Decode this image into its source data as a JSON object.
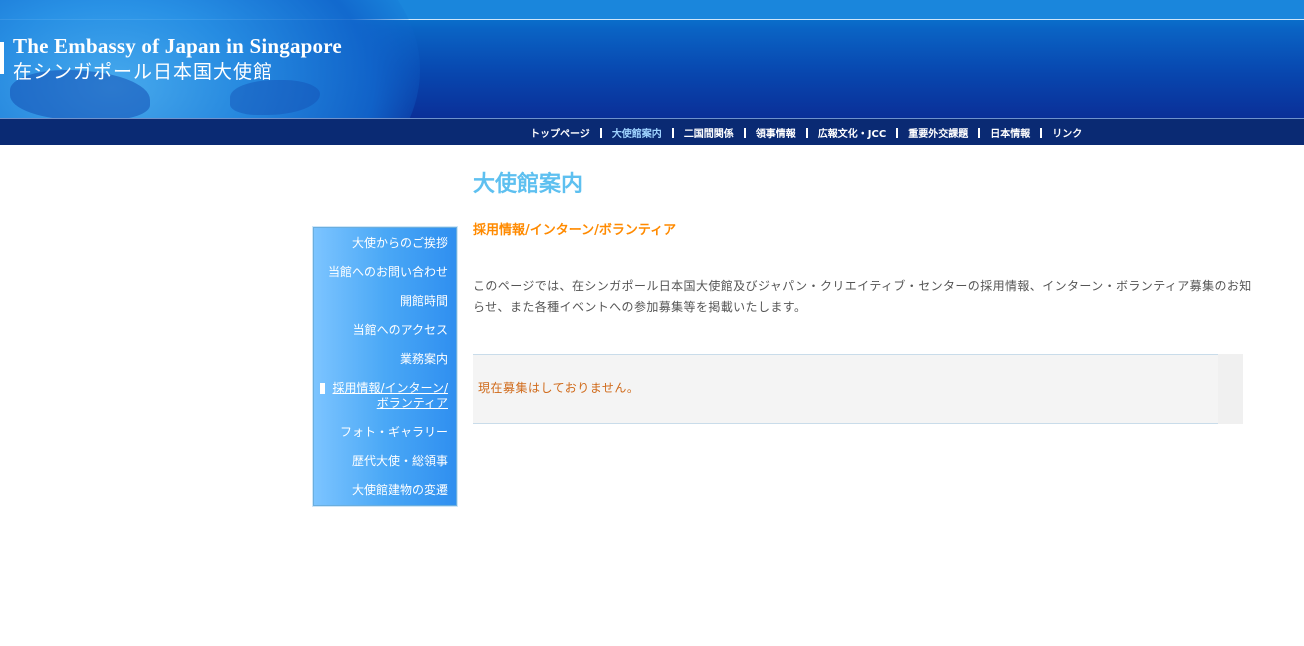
{
  "header": {
    "title_en": "The Embassy of Japan in Singapore",
    "title_ja": "在シンガポール日本国大使館"
  },
  "nav": {
    "items": [
      {
        "label": "トップページ"
      },
      {
        "label": "大使館案内"
      },
      {
        "label": "二国間関係"
      },
      {
        "label": "領事情報"
      },
      {
        "label": "広報文化・JCC"
      },
      {
        "label": "重要外交課題"
      },
      {
        "label": "日本情報"
      },
      {
        "label": "リンク"
      }
    ],
    "active": "大使館案内"
  },
  "sidebar": {
    "items": [
      {
        "label": "大使からのご挨拶"
      },
      {
        "label": "当館へのお問い合わせ"
      },
      {
        "label": "開館時間"
      },
      {
        "label": "当館へのアクセス"
      },
      {
        "label": "業務案内"
      },
      {
        "label": "採用情報/インターン/ボランティア",
        "line1": "採用情報/インターン/",
        "line2": "ボランティア"
      },
      {
        "label": "フォト・ギャラリー"
      },
      {
        "label": "歴代大使・総領事"
      },
      {
        "label": "大使館建物の変遷"
      }
    ]
  },
  "main": {
    "page_title": "大使館案内",
    "section_title": "採用情報/インターン/ボランティア",
    "intro": "このページでは、在シンガポール日本国大使館及びジャパン・クリエイティブ・センターの採用情報、インターン・ボランティア募集のお知らせ、また各種イベントへの参加募集等を掲載いたします。",
    "notice": "現在募集はしておりません。"
  },
  "colors": {
    "header_blue": "#0a63c4",
    "nav_bg": "#0a2a73",
    "page_title": "#5ec0f0",
    "section_title": "#ff8a00",
    "notice_text": "#d06a1a"
  }
}
